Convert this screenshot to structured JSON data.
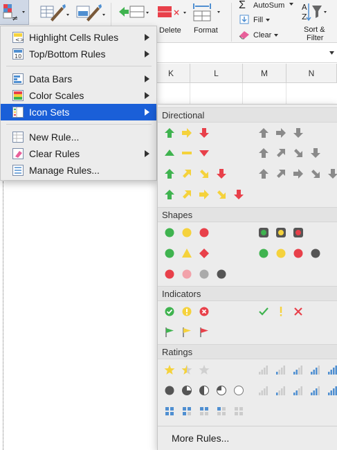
{
  "ribbon": {
    "delete_label": "Delete",
    "format_label": "Format",
    "autosum_label": "AutoSum",
    "fill_label": "Fill",
    "clear_label": "Clear",
    "sort_label": "Sort &",
    "filter_label": "Filter"
  },
  "columns": [
    "K",
    "L",
    "M",
    "N"
  ],
  "menu": {
    "items": [
      {
        "label": "Highlight Cells Rules",
        "icon": "highlight-cells-icon"
      },
      {
        "label": "Top/Bottom Rules",
        "icon": "top-bottom-icon"
      },
      {
        "label": "Data Bars",
        "icon": "data-bars-icon"
      },
      {
        "label": "Color Scales",
        "icon": "color-scales-icon"
      },
      {
        "label": "Icon Sets",
        "icon": "icon-sets-icon"
      },
      {
        "label": "New Rule...",
        "icon": "new-rule-icon"
      },
      {
        "label": "Clear Rules",
        "icon": "clear-rules-icon"
      },
      {
        "label": "Manage Rules...",
        "icon": "manage-rules-icon"
      }
    ],
    "active_item": "Icon Sets"
  },
  "submenu": {
    "sections": {
      "directional": "Directional",
      "shapes": "Shapes",
      "indicators": "Indicators",
      "ratings": "Ratings"
    },
    "more_rules": "More Rules..."
  },
  "colors": {
    "green": "#3fb34f",
    "yellow": "#f5d23c",
    "red": "#e8404a",
    "gray": "#8a8a8a",
    "blue": "#4f8fd1",
    "selection": "#1a5fd8"
  }
}
